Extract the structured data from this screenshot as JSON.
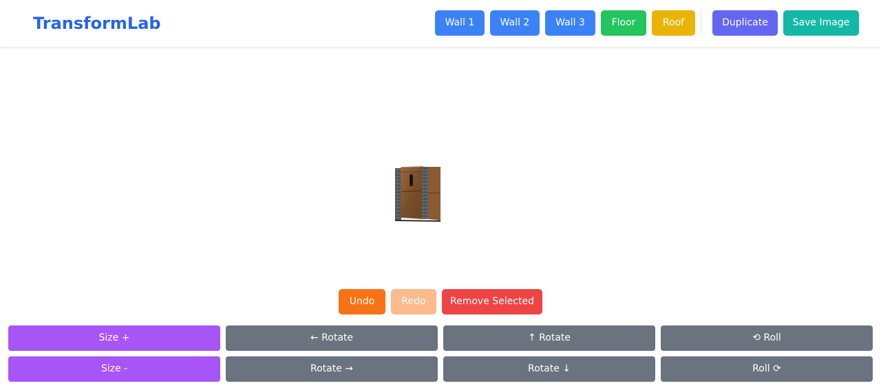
{
  "app": {
    "title": "TransformLab"
  },
  "header": {
    "add_buttons": [
      {
        "label": "Wall 1",
        "color": "#3b82f6"
      },
      {
        "label": "Wall 2",
        "color": "#3b82f6"
      },
      {
        "label": "Wall 3",
        "color": "#3b82f6"
      },
      {
        "label": "Floor",
        "color": "#22c55e"
      },
      {
        "label": "Roof",
        "color": "#eab308"
      }
    ],
    "duplicate_label": "Duplicate",
    "save_image_label": "Save Image"
  },
  "history": {
    "undo_label": "Undo",
    "redo_label": "Redo",
    "remove_selected_label": "Remove Selected"
  },
  "controls": {
    "size_plus": "Size +",
    "size_minus": "Size -",
    "rotate_left": "← Rotate",
    "rotate_right": "Rotate →",
    "rotate_up": "↑ Rotate",
    "rotate_down": "Rotate ↓",
    "roll_ccw": "⟲ Roll",
    "roll_cw": "Roll ⟳"
  },
  "colors": {
    "brand": "#2563eb",
    "wall": "#3b82f6",
    "floor": "#22c55e",
    "roof": "#eab308",
    "duplicate": "#6366f1",
    "save": "#14b8a6",
    "undo": "#f97316",
    "redo_disabled": "#fdba8c",
    "remove": "#ef4444",
    "size": "#a855f7",
    "transform": "#6b7280"
  }
}
